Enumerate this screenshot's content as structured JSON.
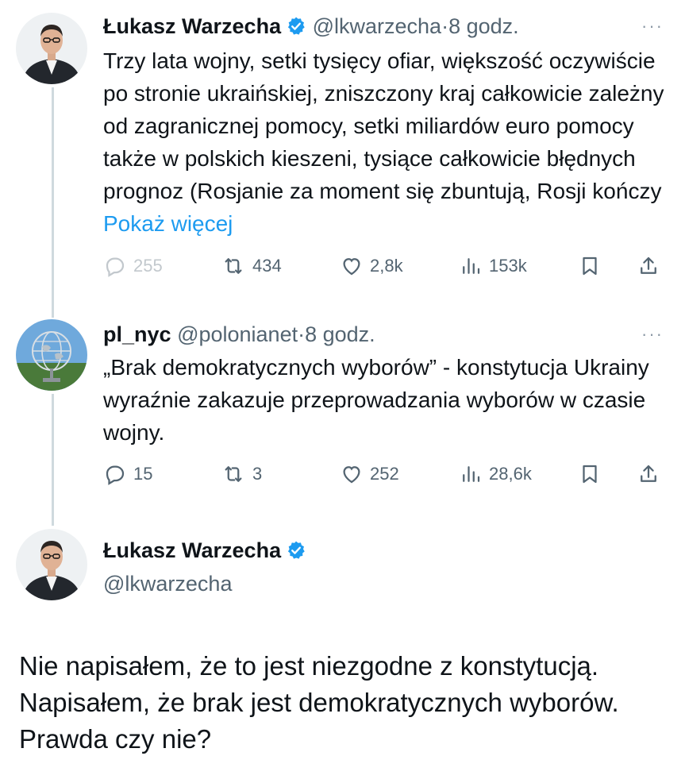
{
  "tweets": [
    {
      "name": "Łukasz Warzecha",
      "handle": "@lkwarzecha",
      "separator": "·",
      "time": "8 godz.",
      "text": "Trzy lata wojny, setki tysięcy ofiar, większość oczywiście po stronie ukraińskiej, zniszczony kraj całkowicie zależny od zagranicznej pomocy, setki miliardów euro pomocy także w polskich kieszeni, tysiące całkowicie błędnych prognoz (Rosjanie za moment się zbuntują, Rosji kończy",
      "show_more": "Pokaż więcej",
      "replies": "255",
      "reposts": "434",
      "likes": "2,8k",
      "views": "153k"
    },
    {
      "name": "pl_nyc",
      "handle": "@polonianet",
      "separator": "·",
      "time": "8 godz.",
      "text": "„Brak demokratycznych wyborów” - konstytucja Ukrainy wyraźnie zakazuje przeprowadzania wyborów w czasie wojny.",
      "replies": "15",
      "reposts": "3",
      "likes": "252",
      "views": "28,6k"
    }
  ],
  "main_tweet": {
    "name": "Łukasz Warzecha",
    "handle": "@lkwarzecha",
    "text": "Nie napisałem, że to jest niezgodne z konstytucją. Napisałem, że brak jest demokratycznych wyborów. Prawda czy nie?"
  },
  "more_glyph": "···",
  "icons": {
    "reply": "reply-icon",
    "repost": "repost-icon",
    "like": "heart-icon",
    "views": "views-icon",
    "bookmark": "bookmark-icon",
    "share": "share-icon",
    "verified": "verified-badge-icon"
  },
  "colors": {
    "text": "#0f1419",
    "secondary": "#536471",
    "link": "#1d9bf0",
    "verified": "#1d9bf0",
    "thread_line": "#cfd9de"
  }
}
